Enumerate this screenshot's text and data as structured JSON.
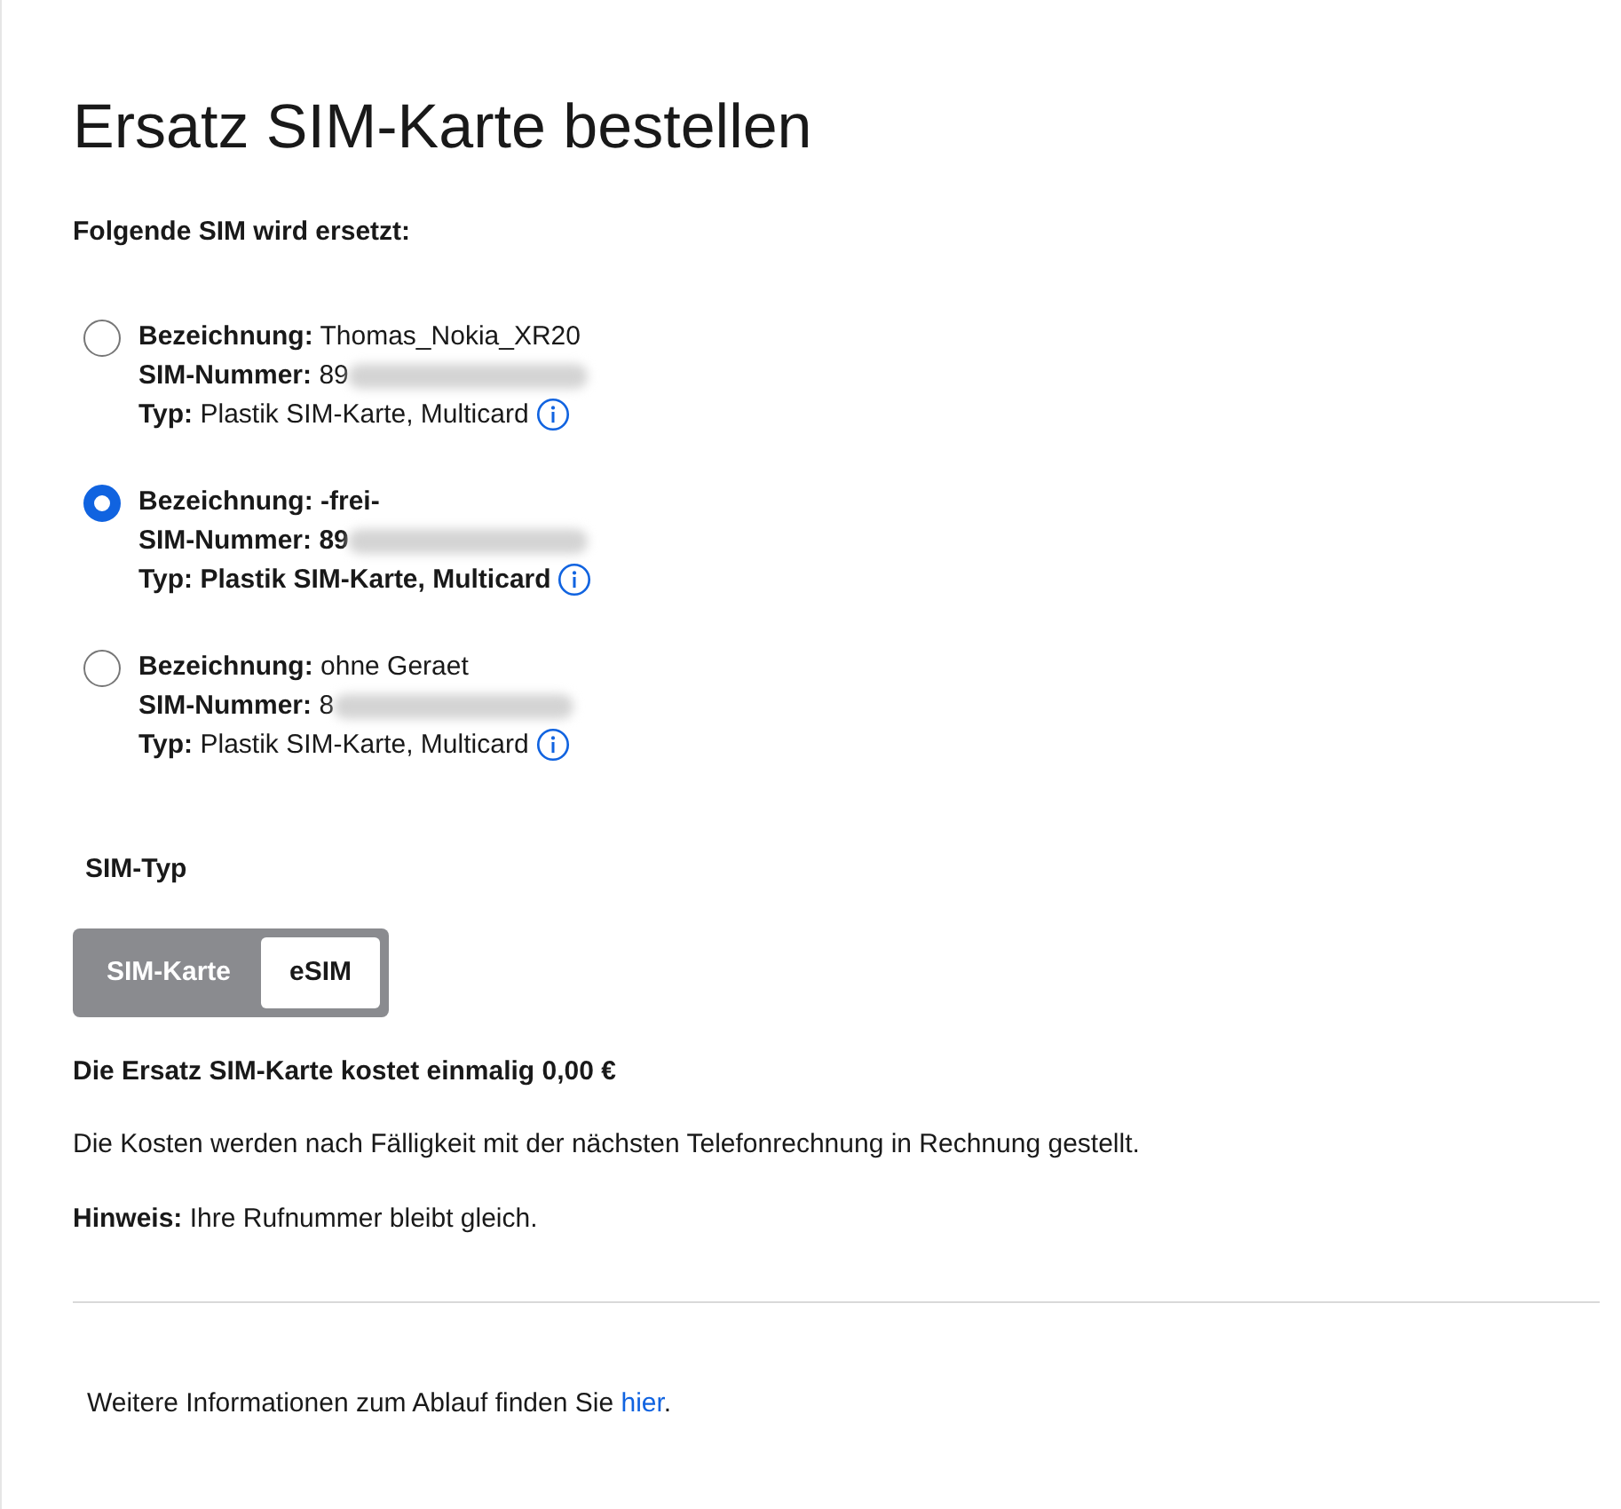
{
  "title": "Ersatz SIM-Karte bestellen",
  "sim_section": {
    "heading": "Folgende SIM wird ersetzt:",
    "sims": [
      {
        "selected": false,
        "lines": [
          {
            "label": "Bezeichnung:",
            "value": "Thomas_Nokia_XR20"
          },
          {
            "label": "SIM-Nummer:",
            "value": "89",
            "redacted": true
          },
          {
            "label": "Typ:",
            "value": "Plastik SIM-Karte, Multicard",
            "info": true
          }
        ]
      },
      {
        "selected": true,
        "lines": [
          {
            "label": "Bezeichnung:",
            "value": "-frei-"
          },
          {
            "label": "SIM-Nummer:",
            "value": "89",
            "redacted": true
          },
          {
            "label": "Typ:",
            "value": "Plastik SIM-Karte, Multicard",
            "info": true
          }
        ]
      },
      {
        "selected": false,
        "lines": [
          {
            "label": "Bezeichnung:",
            "value": "ohne Geraet"
          },
          {
            "label": "SIM-Nummer:",
            "value": "8",
            "redacted": true
          },
          {
            "label": "Typ:",
            "value": "Plastik SIM-Karte, Multicard",
            "info": true
          }
        ]
      }
    ]
  },
  "sim_type": {
    "heading": "SIM-Typ",
    "options": [
      {
        "label": "SIM-Karte",
        "selected": false
      },
      {
        "label": "eSIM",
        "selected": true
      }
    ]
  },
  "price": "Die Ersatz SIM-Karte kostet einmalig 0,00 €",
  "costs_note": "Die Kosten werden nach Fälligkeit mit der nächsten Telefonrechnung in Rechnung gestellt.",
  "hint": "**Hinweis:** Ihre Rufnummer bleibt gleich.",
  "footer": {
    "text_before": "Weitere Informationen zum Ablauf finden Sie ",
    "link": "hier",
    "text_after": "."
  }
}
